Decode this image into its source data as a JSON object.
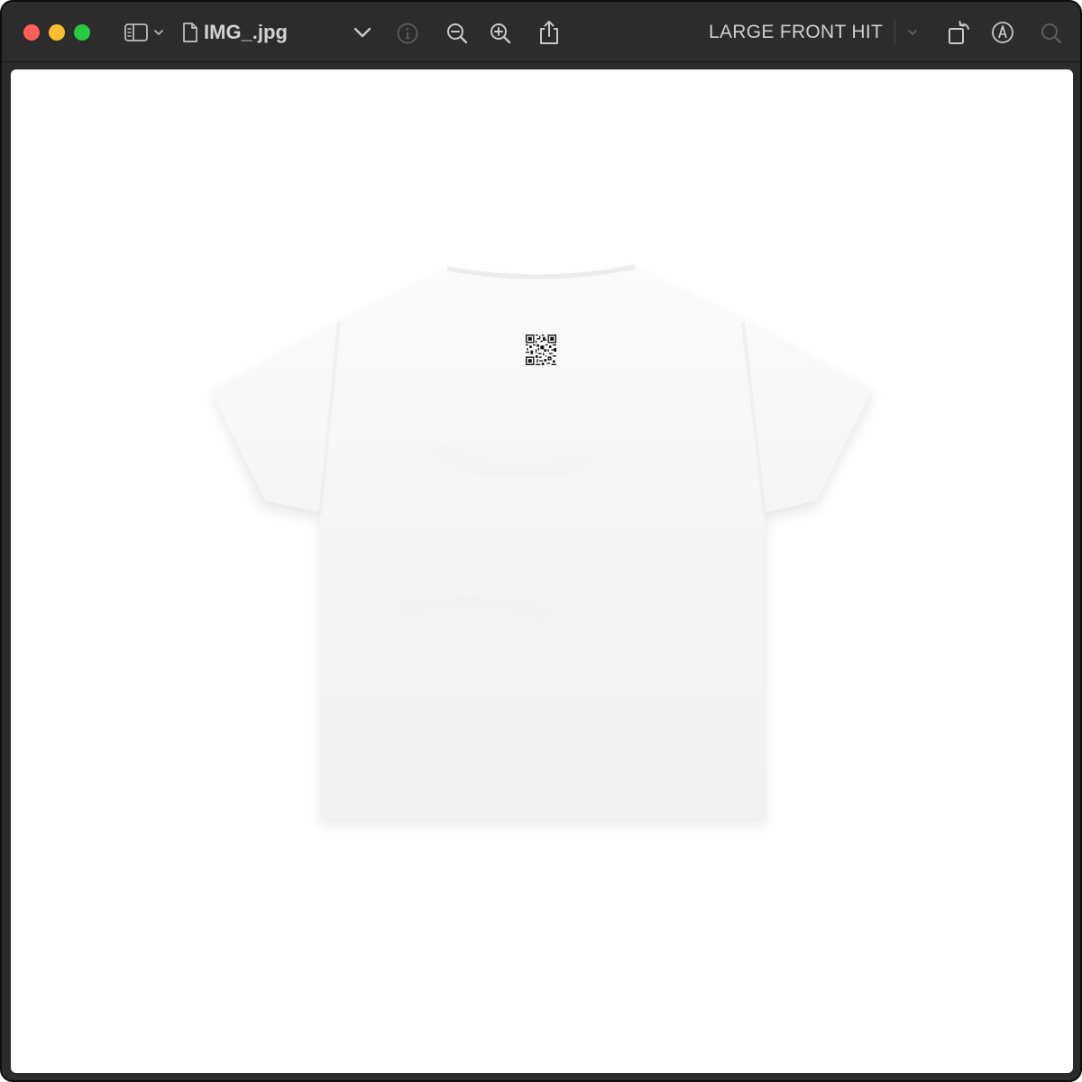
{
  "window": {
    "title": "IMG_.jpg",
    "traffic_lights": {
      "close_color": "#ff5f57",
      "minimize_color": "#febc2e",
      "maximize_color": "#28c840"
    }
  },
  "toolbar": {
    "icons": [
      "sidebar-icon",
      "chevron-down-icon",
      "document-icon",
      "info-icon",
      "zoom-out-icon",
      "zoom-in-icon",
      "share-icon",
      "rotate-icon",
      "markup-icon",
      "search-icon"
    ],
    "markup_label": "LARGE FRONT HIT"
  },
  "image": {
    "subject": "",
    "garment_color": "#f7f7f7",
    "qr_code_color": "#111111"
  }
}
